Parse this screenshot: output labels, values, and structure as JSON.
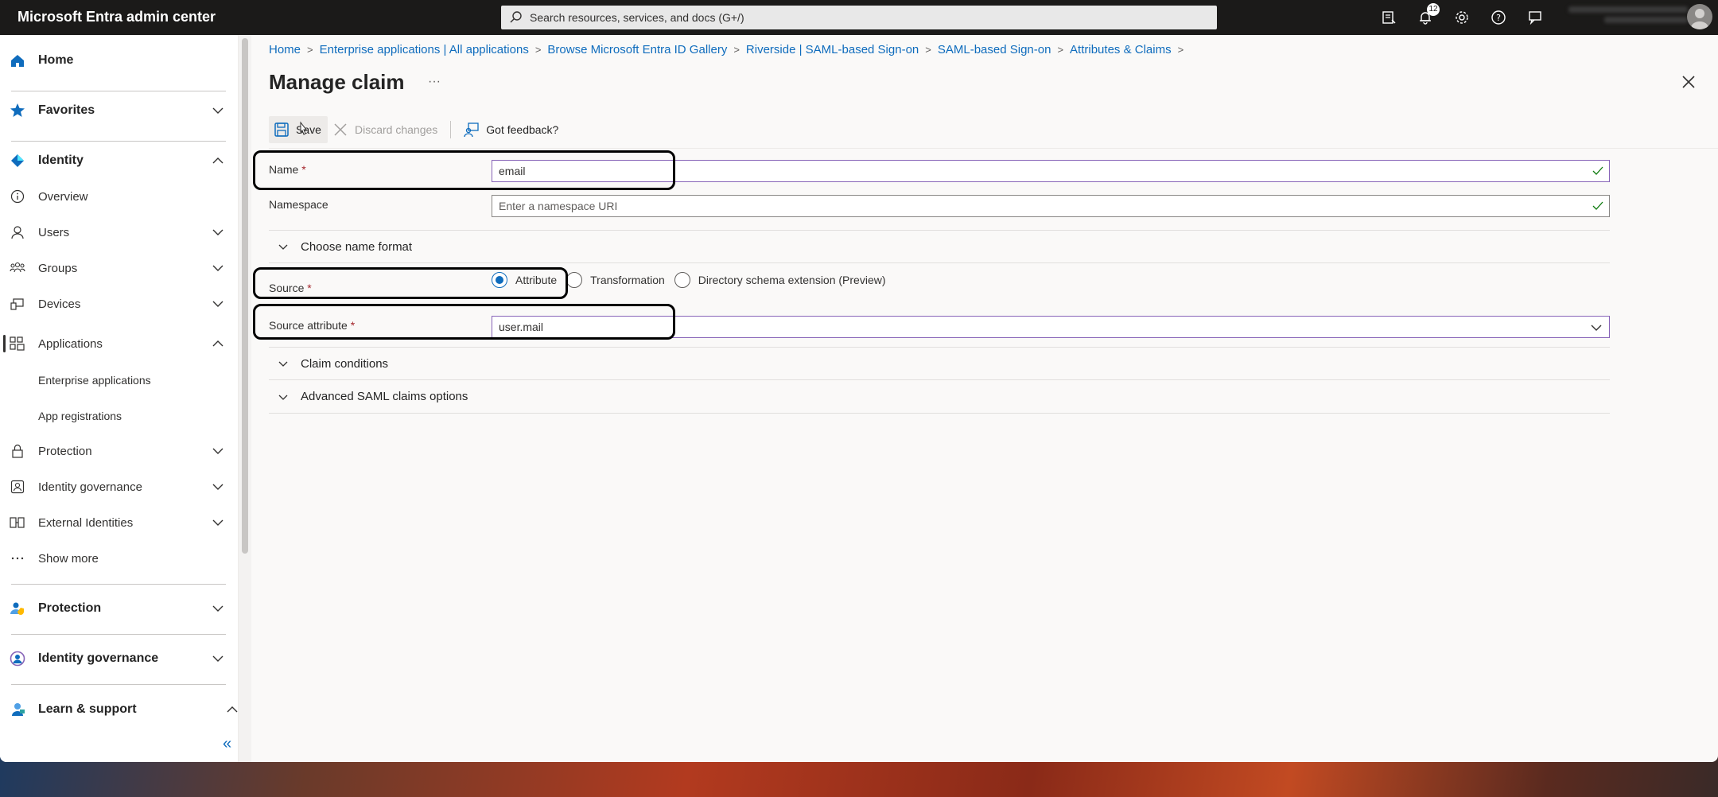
{
  "app": {
    "title": "Microsoft Entra admin center"
  },
  "search": {
    "placeholder": "Search resources, services, and docs (G+/)"
  },
  "topbar": {
    "notification_count": "12"
  },
  "sidebar": {
    "home": "Home",
    "favorites": "Favorites",
    "identity": "Identity",
    "overview": "Overview",
    "users": "Users",
    "groups": "Groups",
    "devices": "Devices",
    "applications": "Applications",
    "enterprise_applications": "Enterprise applications",
    "app_registrations": "App registrations",
    "protection_sub": "Protection",
    "identity_governance_sub": "Identity governance",
    "external_identities": "External Identities",
    "show_more": "Show more",
    "protection": "Protection",
    "identity_governance": "Identity governance",
    "learn_support": "Learn & support",
    "collapse": "«"
  },
  "breadcrumb": [
    "Home",
    "Enterprise applications | All applications",
    "Browse Microsoft Entra ID Gallery",
    "Riverside | SAML-based Sign-on",
    "SAML-based Sign-on",
    "Attributes & Claims"
  ],
  "page": {
    "title": "Manage claim",
    "more": "···"
  },
  "toolbar": {
    "save": "Save",
    "discard": "Discard changes",
    "feedback": "Got feedback?"
  },
  "form": {
    "name_label": "Name",
    "name_value": "email",
    "namespace_label": "Namespace",
    "namespace_placeholder": "Enter a namespace URI",
    "choose_name_format": "Choose name format",
    "source_label": "Source",
    "source_options": [
      "Attribute",
      "Transformation",
      "Directory schema extension (Preview)"
    ],
    "source_selected": "Attribute",
    "source_attribute_label": "Source attribute",
    "source_attribute_value": "user.mail",
    "claim_conditions": "Claim conditions",
    "advanced_saml": "Advanced SAML claims options",
    "required_marker": "*"
  },
  "colors": {
    "topbar": "#1b1a19",
    "accent": "#0f6cbd",
    "input_focus": "#8764b8",
    "required": "#a4262c"
  }
}
